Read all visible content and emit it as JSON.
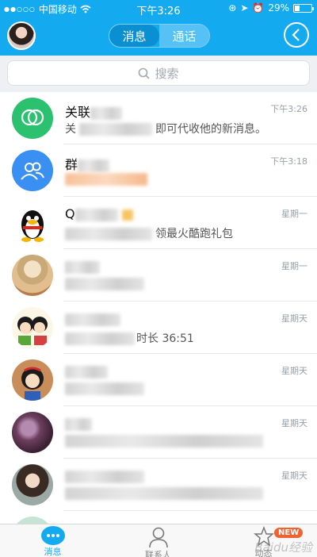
{
  "status_bar": {
    "carrier": "中国移动",
    "time": "下午3:26",
    "battery": "29%",
    "battery_level": 0.29
  },
  "header": {
    "tabs": [
      {
        "label": "消息",
        "active": true
      },
      {
        "label": "通话",
        "active": false
      }
    ],
    "accent_color": "#14aaf0"
  },
  "search": {
    "placeholder": "搜索"
  },
  "conversations": [
    {
      "name": "关联",
      "time": "下午3:26",
      "preview": "即可代收他的新消息。",
      "avatar": "link-icon",
      "color": "#2cc16f"
    },
    {
      "name": "群",
      "time": "下午3:18",
      "preview": "",
      "avatar": "group-icon",
      "color": "#3a8ff2"
    },
    {
      "name": "Q",
      "time": "星期一",
      "preview": "领最火酷跑礼包",
      "avatar": "penguin-avatar"
    },
    {
      "name": "",
      "time": "星期一",
      "preview": "",
      "avatar": "photo-avatar"
    },
    {
      "name": "",
      "time": "星期天",
      "preview": "时长 36:51",
      "avatar": "cartoon-avatar"
    },
    {
      "name": "",
      "time": "星期天",
      "preview": "",
      "avatar": "cartoon-avatar"
    },
    {
      "name": "",
      "time": "星期天",
      "preview": "",
      "avatar": "photo-avatar"
    },
    {
      "name": "",
      "time": "星期天",
      "preview": "",
      "avatar": "photo-avatar"
    }
  ],
  "tab_bar": {
    "tabs": [
      {
        "label": "消息",
        "icon": "chat-bubble-icon",
        "active": true
      },
      {
        "label": "联系人",
        "icon": "person-icon",
        "active": false
      },
      {
        "label": "动态",
        "icon": "star-icon",
        "active": false
      }
    ],
    "badge": "NEW"
  },
  "watermark": "Baidu经验"
}
